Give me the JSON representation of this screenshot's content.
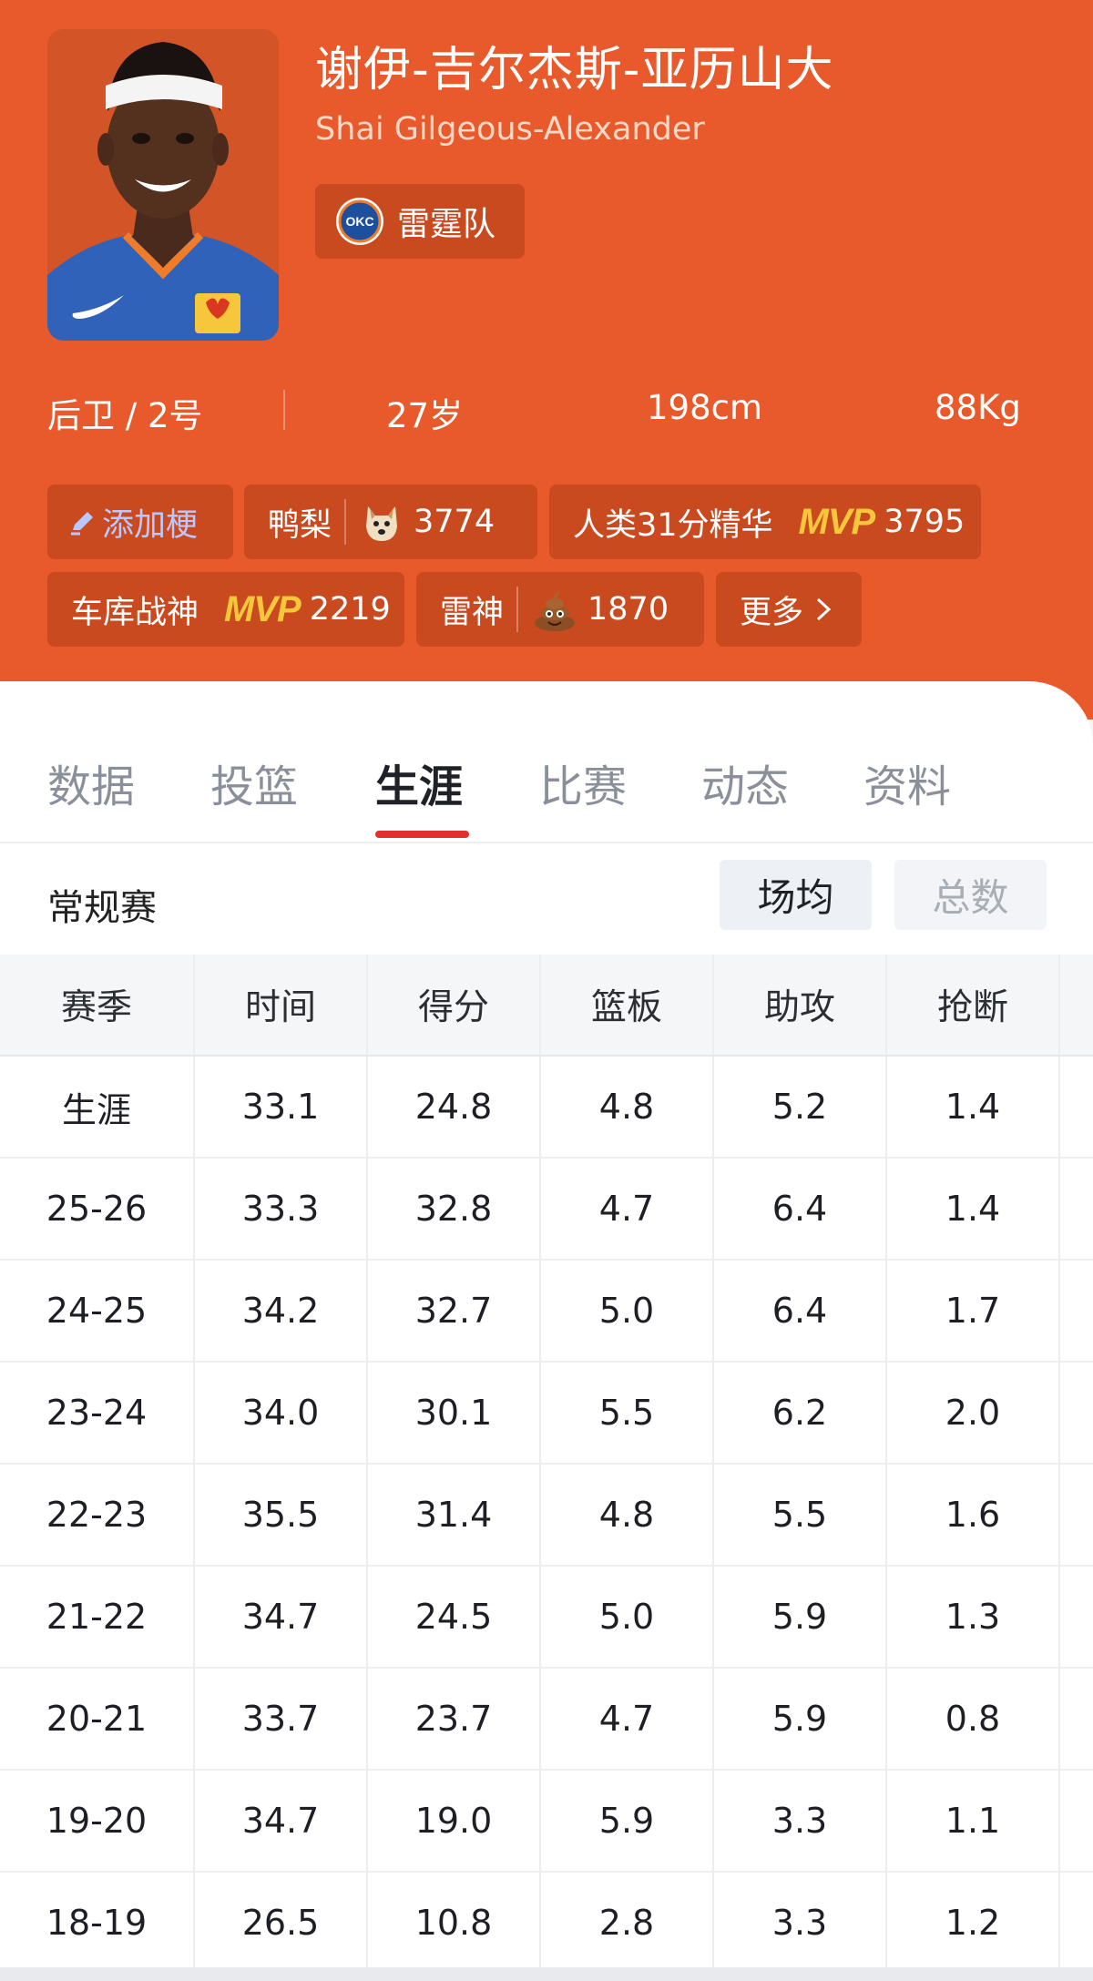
{
  "player": {
    "name_cn": "谢伊-吉尔杰斯-亚历山大",
    "name_en": "Shai Gilgeous-Alexander",
    "team": "雷霆队",
    "team_logo_text": "OKC",
    "position": "后卫 / 2号",
    "age": "27岁",
    "height": "198cm",
    "weight": "88Kg"
  },
  "tags": {
    "add": "添加梗",
    "items": [
      {
        "label": "鸭梨",
        "badge": "doge-icon",
        "count": "3774"
      },
      {
        "label": "人类31分精华",
        "badge": "MVP",
        "count": "3795"
      },
      {
        "label": "车库战神",
        "badge": "MVP",
        "count": "2219"
      },
      {
        "label": "雷神",
        "badge": "poop-icon",
        "count": "1870"
      }
    ],
    "more": "更多"
  },
  "tabs": [
    "数据",
    "投篮",
    "生涯",
    "比赛",
    "动态",
    "资料"
  ],
  "active_tab": "生涯",
  "section": {
    "title": "常规赛",
    "toggle_on": "场均",
    "toggle_off": "总数"
  },
  "table": {
    "headers": [
      "赛季",
      "时间",
      "得分",
      "篮板",
      "助攻",
      "抢断"
    ],
    "rows": [
      [
        "生涯",
        "33.1",
        "24.8",
        "4.8",
        "5.2",
        "1.4"
      ],
      [
        "25-26",
        "33.3",
        "32.8",
        "4.7",
        "6.4",
        "1.4"
      ],
      [
        "24-25",
        "34.2",
        "32.7",
        "5.0",
        "6.4",
        "1.7"
      ],
      [
        "23-24",
        "34.0",
        "30.1",
        "5.5",
        "6.2",
        "2.0"
      ],
      [
        "22-23",
        "35.5",
        "31.4",
        "4.8",
        "5.5",
        "1.6"
      ],
      [
        "21-22",
        "34.7",
        "24.5",
        "5.0",
        "5.9",
        "1.3"
      ],
      [
        "20-21",
        "33.7",
        "23.7",
        "4.7",
        "5.9",
        "0.8"
      ],
      [
        "19-20",
        "34.7",
        "19.0",
        "5.9",
        "3.3",
        "1.1"
      ],
      [
        "18-19",
        "26.5",
        "10.8",
        "2.8",
        "3.3",
        "1.2"
      ]
    ]
  },
  "colors": {
    "header_bg": "#e85a2c",
    "tab_active": "#1f2126",
    "tab_underline": "#e0312f",
    "mvp": "#f6c73a"
  }
}
